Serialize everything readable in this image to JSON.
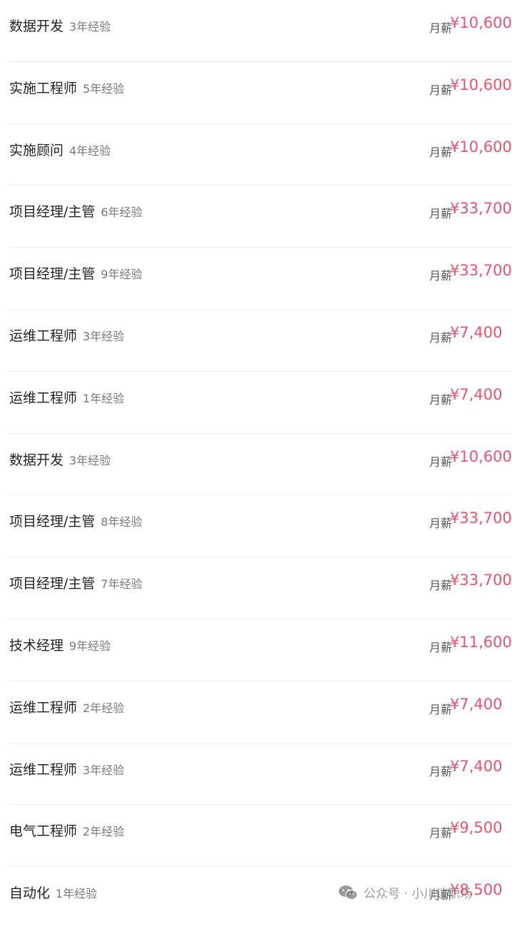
{
  "salary_label": "月薪",
  "rows": [
    {
      "title": "数据开发",
      "exp": "3年经验",
      "salary": "¥10,600"
    },
    {
      "title": "实施工程师",
      "exp": "5年经验",
      "salary": "¥10,600"
    },
    {
      "title": "实施顾问",
      "exp": "4年经验",
      "salary": "¥10,600"
    },
    {
      "title": "项目经理/主管",
      "exp": "6年经验",
      "salary": "¥33,700"
    },
    {
      "title": "项目经理/主管",
      "exp": "9年经验",
      "salary": "¥33,700"
    },
    {
      "title": "运维工程师",
      "exp": "3年经验",
      "salary": "¥7,400"
    },
    {
      "title": "运维工程师",
      "exp": "1年经验",
      "salary": "¥7,400"
    },
    {
      "title": "数据开发",
      "exp": "3年经验",
      "salary": "¥10,600"
    },
    {
      "title": "项目经理/主管",
      "exp": "8年经验",
      "salary": "¥33,700"
    },
    {
      "title": "项目经理/主管",
      "exp": "7年经验",
      "salary": "¥33,700"
    },
    {
      "title": "技术经理",
      "exp": "9年经验",
      "salary": "¥11,600"
    },
    {
      "title": "运维工程师",
      "exp": "2年经验",
      "salary": "¥7,400"
    },
    {
      "title": "运维工程师",
      "exp": "3年经验",
      "salary": "¥7,400"
    },
    {
      "title": "电气工程师",
      "exp": "2年经验",
      "salary": "¥9,500"
    },
    {
      "title": "自动化",
      "exp": "1年经验",
      "salary": "¥8,500"
    }
  ],
  "watermark": {
    "text": "公众号 · 小川谈职场",
    "icon": "wechat-icon"
  },
  "colors": {
    "salary": "#f0516a",
    "title": "#222222",
    "experience": "#777777",
    "divider": "#ececec"
  }
}
